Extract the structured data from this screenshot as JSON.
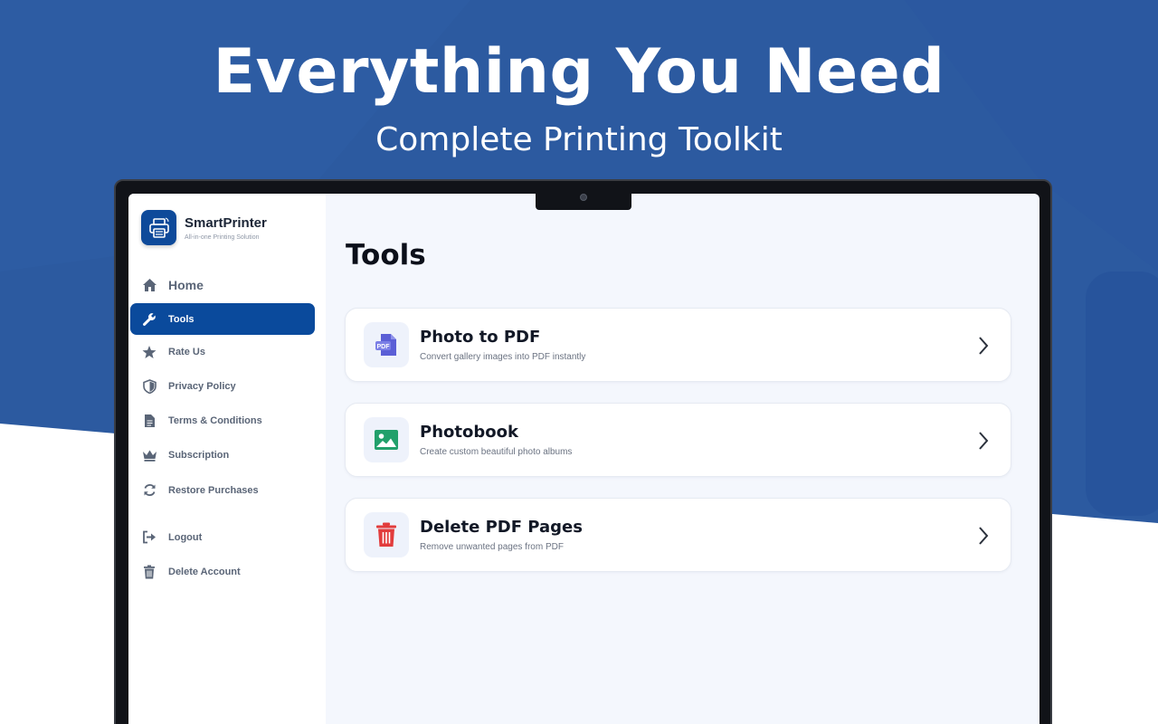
{
  "hero": {
    "title": "Everything You Need",
    "subtitle": "Complete Printing Toolkit"
  },
  "brand": {
    "name": "SmartPrinter",
    "tagline": "All-in-one Printing Solution"
  },
  "sidebar": {
    "items": [
      {
        "label": "Home",
        "icon": "home-icon"
      },
      {
        "label": "Tools",
        "icon": "wrench-icon",
        "active": true
      },
      {
        "label": "Rate Us",
        "icon": "star-icon"
      },
      {
        "label": "Privacy Policy",
        "icon": "shield-icon"
      },
      {
        "label": "Terms & Conditions",
        "icon": "document-icon"
      },
      {
        "label": "Subscription",
        "icon": "crown-icon"
      },
      {
        "label": "Restore Purchases",
        "icon": "refresh-icon"
      },
      {
        "label": "Logout",
        "icon": "logout-icon"
      },
      {
        "label": "Delete Account",
        "icon": "trash-icon"
      }
    ]
  },
  "main": {
    "title": "Tools",
    "tools": [
      {
        "title": "Photo to PDF",
        "description": "Convert gallery images into PDF instantly",
        "icon": "pdf-file-icon",
        "icon_label": "PDF"
      },
      {
        "title": "Photobook",
        "description": "Create custom beautiful photo albums",
        "icon": "image-icon"
      },
      {
        "title": "Delete PDF Pages",
        "description": "Remove unwanted pages from PDF",
        "icon": "trash-icon"
      }
    ]
  },
  "colors": {
    "hero_blue": "#2c5aa0",
    "accent": "#0a4a9c",
    "pdf_purple": "#5b5fd6",
    "photo_green": "#22a06b",
    "delete_red": "#e23c3c"
  }
}
